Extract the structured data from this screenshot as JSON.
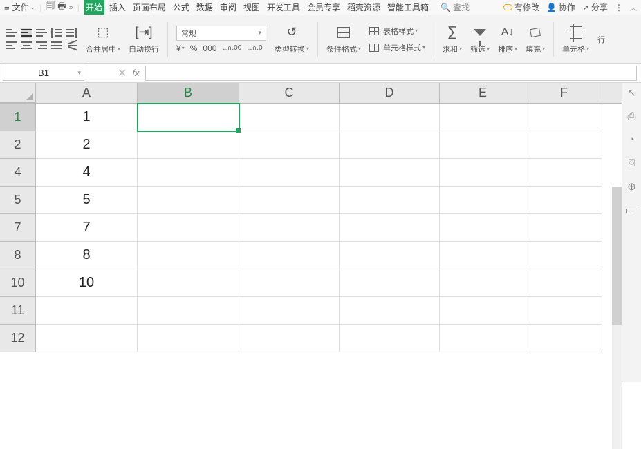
{
  "menubar": {
    "file": "文件",
    "tabs": [
      "开始",
      "插入",
      "页面布局",
      "公式",
      "数据",
      "审阅",
      "视图",
      "开发工具",
      "会员专享",
      "稻壳资源",
      "智能工具箱"
    ],
    "search": "查找",
    "right": {
      "changes": "有修改",
      "collab": "协作",
      "share": "分享"
    }
  },
  "ribbon": {
    "merge": "合并居中",
    "wrap": "自动换行",
    "number_format": "常规",
    "yen": "¥",
    "pct": "%",
    "comma": "000",
    "dec_inc": ".0 0",
    "dec_dec": ".00",
    "type_conv": "类型转换",
    "cond_fmt": "条件格式",
    "table_style": "表格样式",
    "cell_style": "单元格样式",
    "sum": "求和",
    "filter": "筛选",
    "sort": "排序",
    "fill": "填充",
    "cells": "单元格",
    "row": "行"
  },
  "namebox": "B1",
  "columns": [
    "A",
    "B",
    "C",
    "D",
    "E",
    "F"
  ],
  "rows": [
    {
      "h": "1",
      "a": "1"
    },
    {
      "h": "2",
      "a": "2"
    },
    {
      "h": "4",
      "a": "4"
    },
    {
      "h": "5",
      "a": "5"
    },
    {
      "h": "7",
      "a": "7"
    },
    {
      "h": "8",
      "a": "8"
    },
    {
      "h": "10",
      "a": "10"
    },
    {
      "h": "11",
      "a": ""
    },
    {
      "h": "12",
      "a": ""
    }
  ],
  "active": {
    "row": 0,
    "col": "B"
  }
}
